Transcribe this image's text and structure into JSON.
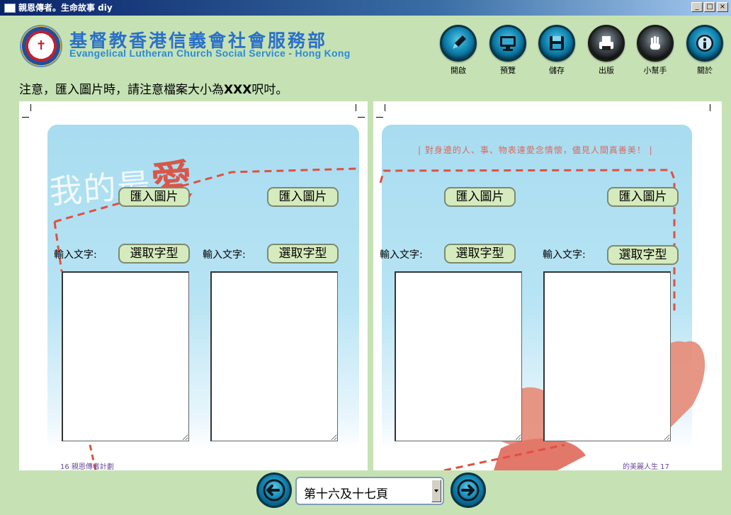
{
  "window": {
    "title": "親恩傳者。生命故事 diy",
    "controls": [
      "_",
      "□",
      "×"
    ]
  },
  "header": {
    "org_name_zh": "基督教香港信義會社會服務部",
    "org_name_en": "Evangelical Lutheran Church Social Service - Hong Kong",
    "logo_cross": "✝"
  },
  "toolbar": [
    {
      "label": "開啟",
      "icon": "pencil-icon"
    },
    {
      "label": "預覽",
      "icon": "monitor-icon"
    },
    {
      "label": "儲存",
      "icon": "floppy-disk-icon"
    },
    {
      "label": "出版",
      "icon": "print-icon"
    },
    {
      "label": "小幫手",
      "icon": "helper-hand-icon"
    },
    {
      "label": "關於",
      "icon": "info-icon"
    }
  ],
  "notice": {
    "text_before": "注意，匯入圖片時，請注意檔案大小為",
    "highlight": "XXX",
    "text_after": "呎吋。"
  },
  "left_page": {
    "title_art": "我的最",
    "title_art_highlight": "愛",
    "import_label": "匯入圖片",
    "font_label": "選取字型",
    "input_label": "輸入文字:",
    "footer": "16   親恩傳者計劃"
  },
  "right_page": {
    "tagline": "| 對身邊的人、事、物表達愛念情懷，儘見人間真善美！ |",
    "import_label": "匯入圖片",
    "font_label": "選取字型",
    "input_label": "輸入文字:",
    "footer": "的美麗人生   17"
  },
  "nav": {
    "current_page": "第十六及十七頁"
  },
  "colors": {
    "background": "#c6e2b4",
    "button_fill": "#d6ebbd",
    "orb_blue": "#1286b3",
    "panel_blue": "#a8dcf0",
    "dash_red": "#e05040"
  }
}
